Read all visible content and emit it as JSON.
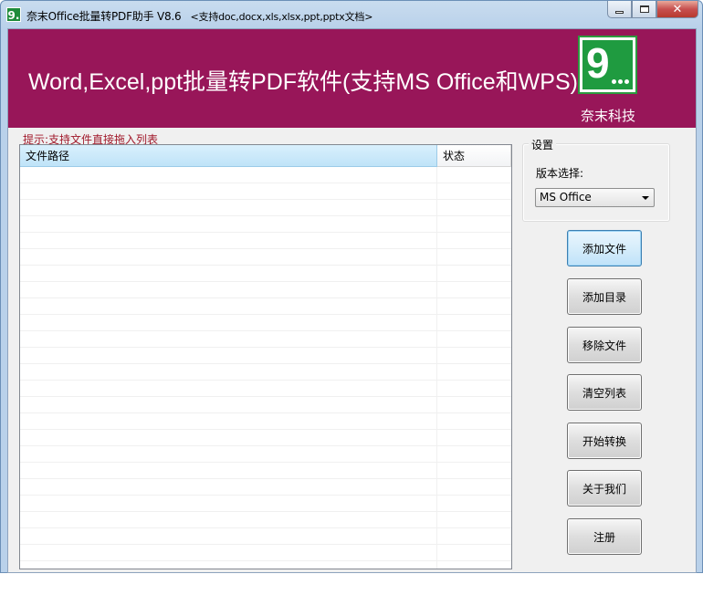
{
  "window": {
    "title": "奈末Office批量转PDF助手 V8.6",
    "subtitle": "<支持doc,docx,xls,xlsx,ppt,pptx文档>",
    "icon_text": "9.",
    "controls": {
      "minimize": "minimize-icon",
      "maximize": "maximize-icon",
      "close": "✕"
    }
  },
  "banner": {
    "title": "Word,Excel,ppt批量转PDF软件(支持MS Office和WPS)",
    "logo_text": "9",
    "company": "奈末科技",
    "background": "#981659",
    "logo_color": "#1f9b40"
  },
  "hint": "提示:支持文件直接拖入列表",
  "file_list": {
    "columns": [
      "文件路径",
      "状态"
    ],
    "rows": []
  },
  "settings": {
    "group_label": "设置",
    "version_label": "版本选择:",
    "version_selected": "MS Office"
  },
  "buttons": [
    "添加文件",
    "添加目录",
    "移除文件",
    "清空列表",
    "开始转换",
    "关于我们",
    "注册"
  ]
}
